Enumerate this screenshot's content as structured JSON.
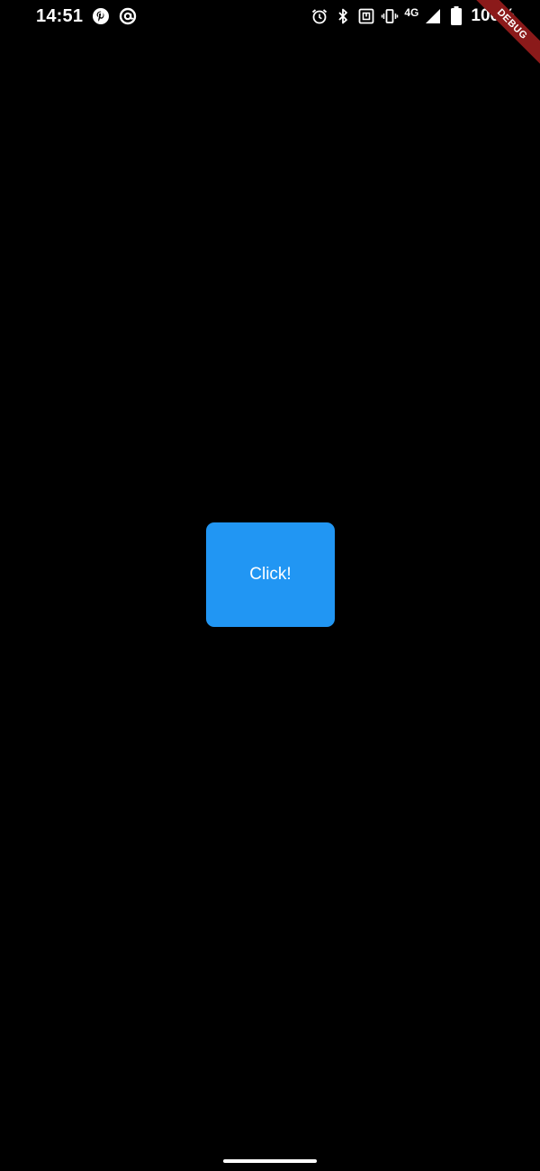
{
  "status_bar": {
    "time": "14:51",
    "network_label": "4G",
    "battery_text": "100%",
    "notification_icons": [
      "pinterest-icon",
      "at-sign-icon"
    ],
    "system_icons": [
      "alarm-icon",
      "bluetooth-icon",
      "nfc-icon",
      "vibrate-icon",
      "signal-icon",
      "battery-icon"
    ]
  },
  "debug_banner": {
    "label": "DEBUG",
    "color": "#8b1a1a"
  },
  "main": {
    "button_label": "Click!",
    "button_color": "#2196f3",
    "background_color": "#000000"
  }
}
